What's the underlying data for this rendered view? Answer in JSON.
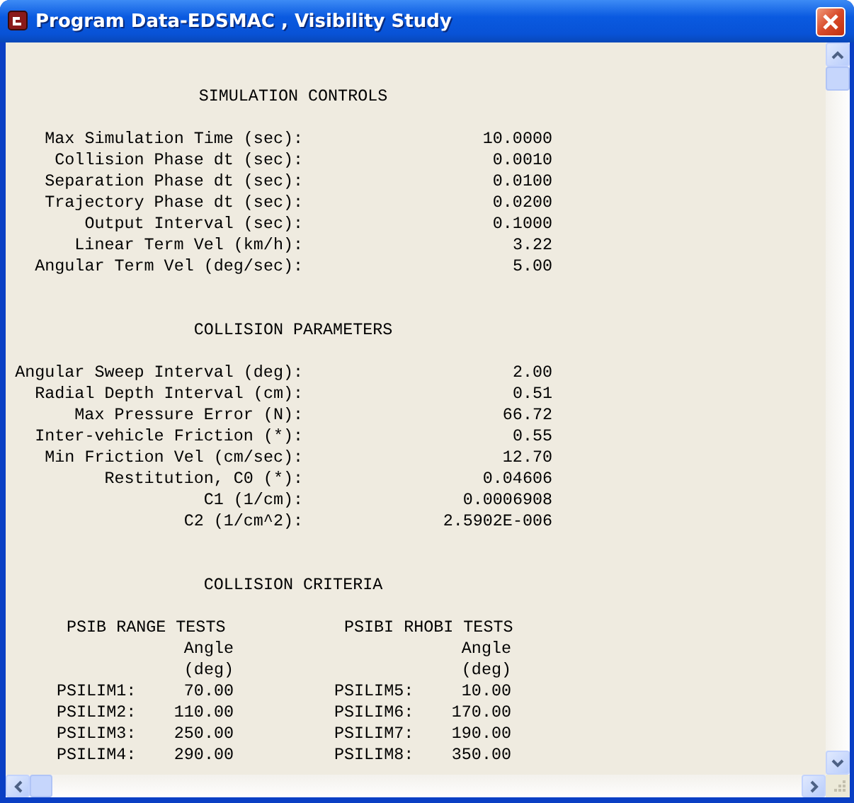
{
  "window": {
    "title": "Program Data-EDSMAC , Visibility Study"
  },
  "sections": [
    {
      "title": "SIMULATION CONTROLS",
      "rows": [
        {
          "label": "Max Simulation Time (sec):",
          "value": "10.0000"
        },
        {
          "label": "Collision Phase dt (sec):",
          "value": "0.0010"
        },
        {
          "label": "Separation Phase dt (sec):",
          "value": "0.0100"
        },
        {
          "label": "Trajectory Phase dt (sec):",
          "value": "0.0200"
        },
        {
          "label": "Output Interval (sec):",
          "value": "0.1000"
        },
        {
          "label": "Linear Term Vel (km/h):",
          "value": "3.22"
        },
        {
          "label": "Angular Term Vel (deg/sec):",
          "value": "5.00"
        }
      ]
    },
    {
      "title": "COLLISION PARAMETERS",
      "rows": [
        {
          "label": "Angular Sweep Interval (deg):",
          "value": "2.00"
        },
        {
          "label": "Radial Depth Interval (cm):",
          "value": "0.51"
        },
        {
          "label": "Max Pressure Error (N):",
          "value": "66.72"
        },
        {
          "label": "Inter-vehicle Friction (*):",
          "value": "0.55"
        },
        {
          "label": "Min Friction Vel (cm/sec):",
          "value": "12.70"
        },
        {
          "label": "Restitution, C0 (*):",
          "value": "0.04606"
        },
        {
          "label": "C1 (1/cm):",
          "value": "0.0006908"
        },
        {
          "label": "C2 (1/cm^2):",
          "value": "2.5902E-006"
        }
      ]
    }
  ],
  "criteria": {
    "title": "COLLISION CRITERIA",
    "groups": [
      {
        "title": "PSIB RANGE TESTS",
        "column_heading": [
          "Angle",
          "(deg)"
        ],
        "rows": [
          {
            "label": "PSILIM1:",
            "value": "70.00"
          },
          {
            "label": "PSILIM2:",
            "value": "110.00"
          },
          {
            "label": "PSILIM3:",
            "value": "250.00"
          },
          {
            "label": "PSILIM4:",
            "value": "290.00"
          }
        ]
      },
      {
        "title": "PSIBI RHOBI TESTS",
        "column_heading": [
          "Angle",
          "(deg)"
        ],
        "rows": [
          {
            "label": "PSILIM5:",
            "value": "10.00"
          },
          {
            "label": "PSILIM6:",
            "value": "170.00"
          },
          {
            "label": "PSILIM7:",
            "value": "190.00"
          },
          {
            "label": "PSILIM8:",
            "value": "350.00"
          }
        ]
      }
    ]
  }
}
